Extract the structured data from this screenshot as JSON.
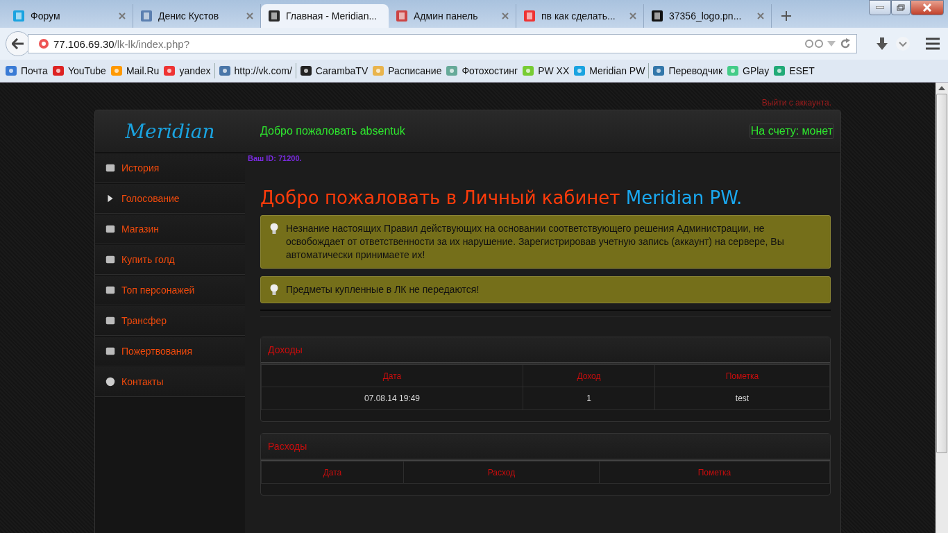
{
  "browser": {
    "tabs": [
      {
        "title": "Форум",
        "selected": false
      },
      {
        "title": "Денис Кустов",
        "selected": false
      },
      {
        "title": "Главная - Meridian...",
        "selected": true
      },
      {
        "title": "Админ панель",
        "selected": false
      },
      {
        "title": "пв как сделать...",
        "selected": false
      },
      {
        "title": "37356_logo.pn...",
        "selected": false
      }
    ],
    "address": {
      "host": "77.106.69.30",
      "path": "/lk-lk/index.php?"
    },
    "bookmarks": [
      "Почта",
      "YouTube",
      "Mail.Ru",
      "yandex",
      "http://vk.com/",
      "CarambaTV",
      "Расписание",
      "Фотохостинг",
      "PW XX",
      "Meridian PW",
      "Переводчик",
      "GPlay",
      "ESET"
    ]
  },
  "page": {
    "logout": "Выйти с аккаунта.",
    "logo": "Meridian",
    "welcome": "Добро пожаловать absentuk",
    "balance": "На счету: монет",
    "menu": [
      "История",
      "Голосование",
      "Магазин",
      "Купить голд",
      "Топ персонажей",
      "Трансфер",
      "Пожертвования",
      "Контакты"
    ],
    "user_id": "Ваш ID: 71200.",
    "heading": {
      "text": "Добро пожаловать в Личный кабинет",
      "highlight": "Meridian PW."
    },
    "notices": [
      "Незнание настоящих Правил действующих на основании соответствующего решения Администрации, не освобождает от ответственности за их нарушение. Зарегистрировав учетную запись (аккаунт) на сервере, Вы автоматически принимаете их!",
      "Предметы купленные в ЛК не передаются!"
    ],
    "income": {
      "title": "Доходы",
      "columns": [
        "Дата",
        "Доход",
        "Пометка"
      ],
      "rows": [
        [
          "07.08.14 19:49",
          "1",
          "test"
        ]
      ]
    },
    "expenses": {
      "title": "Расходы",
      "columns": [
        "Дата",
        "Расход",
        "Пометка"
      ]
    }
  }
}
